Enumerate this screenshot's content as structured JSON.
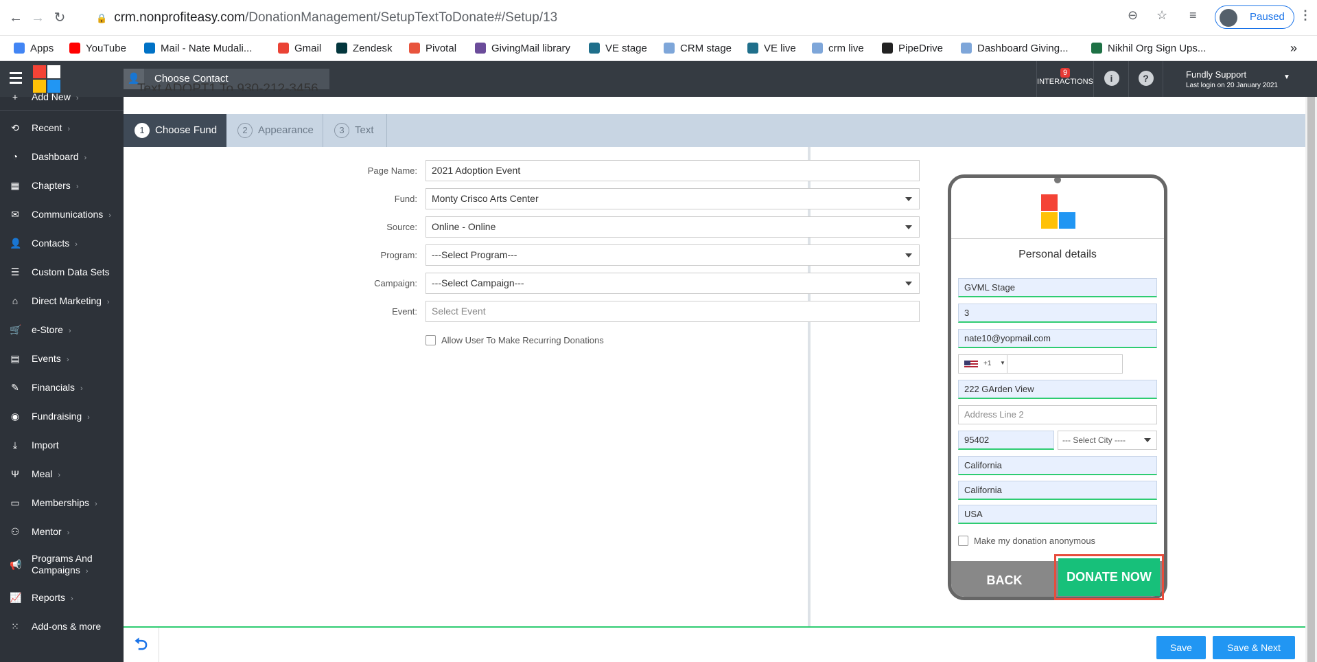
{
  "browser": {
    "url_host": "crm.nonprofiteasy.com",
    "url_path": "/DonationManagement/SetupTextToDonate#/Setup/13",
    "paused_label": "Paused"
  },
  "bookmarks": [
    {
      "label": "Apps",
      "color": "#4285f4"
    },
    {
      "label": "YouTube",
      "color": "#ff0000"
    },
    {
      "label": "Mail - Nate Mudali...",
      "color": "#0072c6"
    },
    {
      "label": "Gmail",
      "color": "#ea4335"
    },
    {
      "label": "Zendesk",
      "color": "#03363d"
    },
    {
      "label": "Pivotal",
      "color": "#e8543d"
    },
    {
      "label": "GivingMail library",
      "color": "#6b4c9a"
    },
    {
      "label": "VE stage",
      "color": "#1f6f8b"
    },
    {
      "label": "CRM stage",
      "color": "#7ea6d9"
    },
    {
      "label": "VE live",
      "color": "#1f6f8b"
    },
    {
      "label": "crm live",
      "color": "#7ea6d9"
    },
    {
      "label": "PipeDrive",
      "color": "#222222"
    },
    {
      "label": "Dashboard Giving...",
      "color": "#7ea6d9"
    },
    {
      "label": "Nikhil Org Sign Ups...",
      "color": "#1e7145"
    }
  ],
  "sidebar": {
    "items": [
      {
        "label": "Add New",
        "icon": "plus-icon",
        "glyph": "+"
      },
      {
        "label": "Recent",
        "icon": "history-icon",
        "glyph": "⟲"
      },
      {
        "label": "Dashboard",
        "icon": "dashboard-icon",
        "glyph": "◔"
      },
      {
        "label": "Chapters",
        "icon": "grid-icon",
        "glyph": "▦"
      },
      {
        "label": "Communications",
        "icon": "envelope-icon",
        "glyph": "✉"
      },
      {
        "label": "Contacts",
        "icon": "user-icon",
        "glyph": "👤"
      },
      {
        "label": "Custom Data Sets",
        "icon": "database-icon",
        "glyph": "☰"
      },
      {
        "label": "Direct Marketing",
        "icon": "bank-icon",
        "glyph": "⌂"
      },
      {
        "label": "e-Store",
        "icon": "cart-icon",
        "glyph": "🛒"
      },
      {
        "label": "Events",
        "icon": "calendar-icon",
        "glyph": "▤"
      },
      {
        "label": "Financials",
        "icon": "money-icon",
        "glyph": "✎"
      },
      {
        "label": "Fundraising",
        "icon": "medal-icon",
        "glyph": "◉"
      },
      {
        "label": "Import",
        "icon": "download-icon",
        "glyph": "⤓"
      },
      {
        "label": "Meal",
        "icon": "cutlery-icon",
        "glyph": "Ψ"
      },
      {
        "label": "Memberships",
        "icon": "id-card-icon",
        "glyph": "▭"
      },
      {
        "label": "Mentor",
        "icon": "sitemap-icon",
        "glyph": "⚇"
      },
      {
        "label": "Programs And Campaigns",
        "icon": "megaphone-icon",
        "glyph": "📢"
      },
      {
        "label": "Reports",
        "icon": "chart-icon",
        "glyph": "📈"
      },
      {
        "label": "Add-ons & more",
        "icon": "apps-icon",
        "glyph": "⁙"
      }
    ]
  },
  "topbar": {
    "choose_contact": "Choose Contact",
    "interactions_count": "9",
    "interactions_label": "INTERACTIONS",
    "user_name": "Fundly Support",
    "last_login": "Last login on 20 January 2021"
  },
  "header_cut": "Text ADOPT1 To 930-212-3456",
  "steps": [
    {
      "num": "1",
      "label": "Choose Fund"
    },
    {
      "num": "2",
      "label": "Appearance"
    },
    {
      "num": "3",
      "label": "Text"
    }
  ],
  "form": {
    "page_name_label": "Page Name:",
    "page_name_value": "2021 Adoption Event",
    "fund_label": "Fund:",
    "fund_value": "Monty Crisco Arts Center",
    "source_label": "Source:",
    "source_value": "Online - Online",
    "program_label": "Program:",
    "program_value": "---Select Program---",
    "campaign_label": "Campaign:",
    "campaign_value": "---Select Campaign---",
    "event_label": "Event:",
    "event_placeholder": "Select Event",
    "recurring_label": "Allow User To Make Recurring Donations"
  },
  "preview": {
    "title": "Personal details",
    "name": "GVML Stage",
    "field2": "3",
    "email": "nate10@yopmail.com",
    "country_code": "+1",
    "address1": "222 GArden View",
    "address2_placeholder": "Address Line 2",
    "zip": "95402",
    "city_placeholder": "--- Select City ----",
    "state": "California",
    "county": "California",
    "country": "USA",
    "anonymous_label": "Make my donation anonymous",
    "back_label": "BACK",
    "donate_label": "DONATE NOW"
  },
  "footer": {
    "save_label": "Save",
    "save_next_label": "Save & Next"
  },
  "colors": {
    "sidebar_bg": "#2d3239",
    "accent_blue": "#2196f3",
    "donate_green": "#17c07a",
    "highlight_red": "#e74c3c"
  }
}
